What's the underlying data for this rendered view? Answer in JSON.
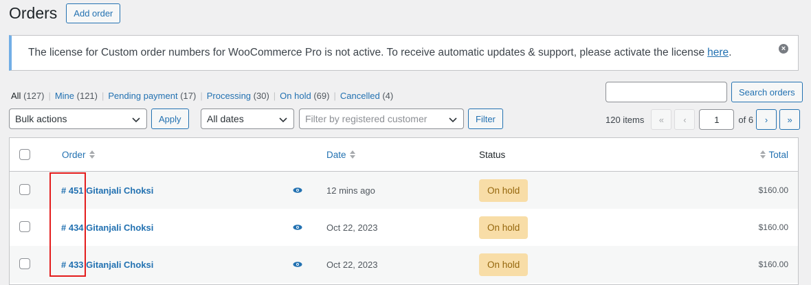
{
  "header": {
    "title": "Orders",
    "add_order_label": "Add order"
  },
  "notice": {
    "text": "The license for Custom order numbers for WooCommerce Pro is not active. To receive automatic updates & support, please activate the license ",
    "link_text": "here",
    "after_link": "."
  },
  "views": [
    {
      "label": "All",
      "count": "(127)"
    },
    {
      "label": "Mine",
      "count": "(121)"
    },
    {
      "label": "Pending payment",
      "count": "(17)"
    },
    {
      "label": "Processing",
      "count": "(30)"
    },
    {
      "label": "On hold",
      "count": "(69)"
    },
    {
      "label": "Cancelled",
      "count": "(4)"
    }
  ],
  "search": {
    "button_label": "Search orders",
    "value": ""
  },
  "filters": {
    "bulk_actions": "Bulk actions",
    "apply_label": "Apply",
    "dates": "All dates",
    "customer_placeholder": "Filter by registered customer",
    "filter_label": "Filter"
  },
  "pagination": {
    "items": "120 items",
    "first": "«",
    "prev": "‹",
    "current": "1",
    "of": "of 6",
    "next": "›",
    "last": "»"
  },
  "table": {
    "headers": {
      "order": "Order",
      "date": "Date",
      "status": "Status",
      "total": "Total"
    },
    "rows": [
      {
        "order": "# 451 Gitanjali Choksi",
        "date": "12 mins ago",
        "status": "On hold",
        "total": "$160.00"
      },
      {
        "order": "# 434 Gitanjali Choksi",
        "date": "Oct 22, 2023",
        "status": "On hold",
        "total": "$160.00"
      },
      {
        "order": "# 433 Gitanjali Choksi",
        "date": "Oct 22, 2023",
        "status": "On hold",
        "total": "$160.00"
      }
    ]
  },
  "icons": {
    "dismiss": "close-circle-icon",
    "preview": "eye-icon",
    "sort": "sort-arrows-icon",
    "dropdown": "chevron-down-icon"
  },
  "colors": {
    "accent": "#2271b1",
    "notice_border": "#72aee6",
    "status_on_hold_bg": "#f8dda7",
    "status_on_hold_text": "#94660c",
    "highlight": "#e31b1b"
  }
}
